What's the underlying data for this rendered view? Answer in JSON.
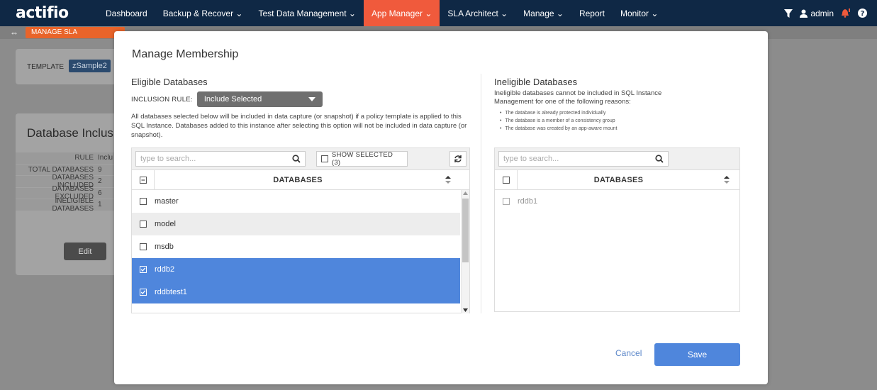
{
  "app": {
    "logo": "actifio"
  },
  "nav": {
    "items": [
      {
        "label": "Dashboard",
        "active": false
      },
      {
        "label": "Backup & Recover ⌄",
        "active": false
      },
      {
        "label": "Test Data Management ⌄",
        "active": false
      },
      {
        "label": "App Manager ⌄",
        "active": true
      },
      {
        "label": "SLA Architect ⌄",
        "active": false
      },
      {
        "label": "Manage ⌄",
        "active": false
      },
      {
        "label": "Report",
        "active": false
      },
      {
        "label": "Monitor ⌄",
        "active": false
      }
    ],
    "user": "admin"
  },
  "subbar": {
    "manage_sla": "MANAGE SLA"
  },
  "background": {
    "template_label": "TEMPLATE",
    "template_value": "zSample2",
    "section_title": "Database Inclusio",
    "stats": [
      {
        "k": "RULE",
        "v": "Inclu"
      },
      {
        "k": "TOTAL DATABASES",
        "v": "9"
      },
      {
        "k": "DATABASES INCLUDED",
        "v": "2"
      },
      {
        "k": "DATABASES EXCLUDED",
        "v": "6"
      },
      {
        "k": "INELIGIBLE DATABASES",
        "v": "1"
      }
    ],
    "edit_label": "Edit"
  },
  "modal": {
    "title": "Manage Membership",
    "eligible": {
      "title": "Eligible Databases",
      "inclusion_label": "INCLUSION RULE:",
      "inclusion_value": "Include Selected",
      "description": "All databases selected below will be included in data capture (or snapshot) if a policy template is applied to this SQL Instance. Databases added to this instance after selecting this option will not be included in data capture (or snapshot).",
      "search_placeholder": "type to search...",
      "show_selected": "SHOW SELECTED (3)",
      "column_header": "DATABASES",
      "rows": [
        {
          "name": "master",
          "selected": false
        },
        {
          "name": "model",
          "selected": false
        },
        {
          "name": "msdb",
          "selected": false
        },
        {
          "name": "rddb2",
          "selected": true
        },
        {
          "name": "rddbtest1",
          "selected": true
        }
      ]
    },
    "ineligible": {
      "title": "Ineligible Databases",
      "description": "Ineligible databases cannot be included in SQL Instance Management for one of the following reasons:",
      "reasons": [
        "The database is already protected individually",
        "The database is a member of a consistency group",
        "The database was created by an app-aware mount"
      ],
      "search_placeholder": "type to search...",
      "column_header": "DATABASES",
      "rows": [
        {
          "name": "rddb1"
        }
      ]
    },
    "cancel_label": "Cancel",
    "save_label": "Save"
  },
  "colors": {
    "nav_bg": "#0f2845",
    "active_tab": "#f05a3c",
    "accent": "#4f86dc",
    "manage_sla": "#e9642a"
  }
}
